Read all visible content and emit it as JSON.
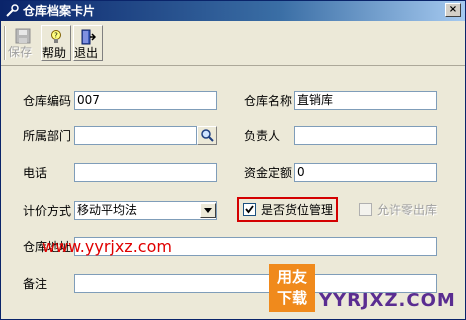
{
  "window": {
    "title": "仓库档案卡片",
    "close_label": "×"
  },
  "toolbar": {
    "items": [
      {
        "label": "保存",
        "icon": "floppy-disk-icon",
        "enabled": false
      },
      {
        "label": "帮助",
        "icon": "help-bulb-icon",
        "enabled": true
      },
      {
        "label": "退出",
        "icon": "exit-door-icon",
        "enabled": true
      }
    ]
  },
  "form": {
    "warehouse_code": {
      "label": "仓库编码",
      "value": "007"
    },
    "warehouse_name": {
      "label": "仓库名称",
      "value": "直销库"
    },
    "department": {
      "label": "所属部门",
      "value": ""
    },
    "manager": {
      "label": "负责人",
      "value": ""
    },
    "phone": {
      "label": "电话",
      "value": ""
    },
    "fund_quota": {
      "label": "资金定额",
      "value": "0"
    },
    "valuation_method": {
      "label": "计价方式",
      "value": "移动平均法"
    },
    "location_managed": {
      "label": "是否货位管理",
      "checked": true
    },
    "allow_negative": {
      "label": "允许零出库",
      "checked": false,
      "enabled": false
    },
    "address": {
      "label": "仓库地址",
      "value": ""
    },
    "remarks": {
      "label": "备注",
      "value": ""
    }
  },
  "watermark": {
    "url": "www.yyrjxz.com",
    "logo_top": "用友",
    "logo_bottom": "下载",
    "logo_text": "YYRJXZ.COM"
  },
  "colors": {
    "title_gradient_start": "#0a246a",
    "highlight": "#d40000",
    "watermark": "#e00000",
    "logo_orange": "#f08a1c",
    "logo_purple": "#5a2d91"
  }
}
